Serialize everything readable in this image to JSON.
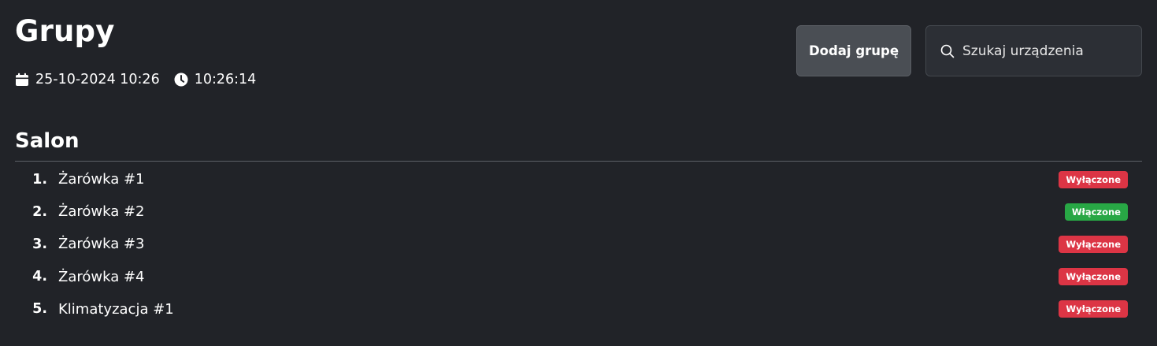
{
  "header": {
    "title": "Grupy",
    "date": "25-10-2024 10:26",
    "time": "10:26:14",
    "date_icon": "calendar-icon",
    "time_icon": "clock-icon"
  },
  "toolbar": {
    "add_group_label": "Dodaj grupę",
    "search_placeholder": "Szukaj urządzenia",
    "search_value": "",
    "search_icon": "search-icon"
  },
  "group": {
    "name": "Salon",
    "devices": [
      {
        "number": "1.",
        "name": "Żarówka #1",
        "status": "Wyłączone",
        "state": "off"
      },
      {
        "number": "2.",
        "name": "Żarówka #2",
        "status": "Włączone",
        "state": "on"
      },
      {
        "number": "3.",
        "name": "Żarówka #3",
        "status": "Wyłączone",
        "state": "off"
      },
      {
        "number": "4.",
        "name": "Żarówka #4",
        "status": "Wyłączone",
        "state": "off"
      },
      {
        "number": "5.",
        "name": "Klimatyzacja #1",
        "status": "Wyłączone",
        "state": "off"
      }
    ]
  },
  "colors": {
    "background": "#212328",
    "status_off": "#dc3545",
    "status_on": "#28a745",
    "button_bg": "#4a4e54"
  }
}
